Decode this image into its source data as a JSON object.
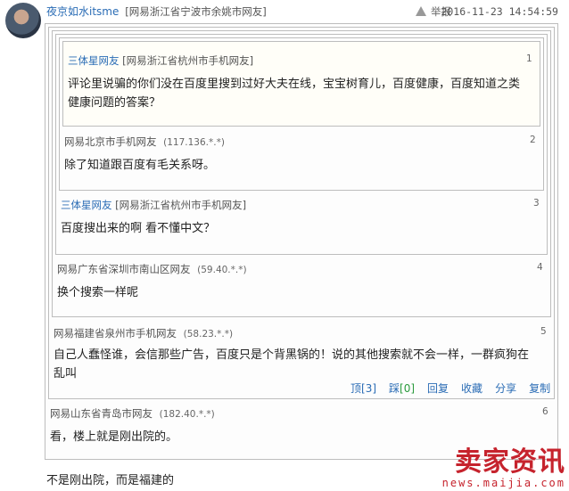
{
  "post": {
    "username": "夜京如水itsme",
    "location": "[网易浙江省宁波市余姚市网友]",
    "report_label": "举报",
    "timestamp": "2016-11-23 14:54:59",
    "text": "不是刚出院，而是福建的"
  },
  "floors": [
    {
      "num": "1",
      "name": "三体星网友",
      "meta": "[网易浙江省杭州市手机网友]",
      "text_lines": [
        "评论里说骗的你们没在百度里搜到过好大夫在线，宝宝树育儿，百度健康，百度知道之类",
        "健康问题的答案？"
      ]
    },
    {
      "num": "2",
      "name": "网易北京市手机网友",
      "ip": "(117.136.*.*)",
      "text_lines": [
        "除了知道跟百度有毛关系呀。"
      ]
    },
    {
      "num": "3",
      "name": "三体星网友",
      "meta": "[网易浙江省杭州市手机网友]",
      "text_lines": [
        "百度搜出来的啊 看不懂中文？"
      ]
    },
    {
      "num": "4",
      "name": "网易广东省深圳市南山区网友",
      "ip": "(59.40.*.*)",
      "text_lines": [
        "换个搜索一样呢"
      ]
    },
    {
      "num": "5",
      "name": "网易福建省泉州市手机网友",
      "ip": "(58.23.*.*)",
      "text_lines": [
        "自己人蠢怪谁，会信那些广告，百度只是个背黑锅的！说的其他搜索就不会一样，一群疯狗在",
        "乱叫"
      ]
    },
    {
      "num": "6",
      "name": "网易山东省青岛市网友",
      "ip": "(182.40.*.*)",
      "text_lines": [
        "看，楼上就是刚出院的。"
      ]
    }
  ],
  "actions": {
    "up_label": "顶",
    "up_count": "[3]",
    "down_label": "踩",
    "down_count": "[0]",
    "reply": "回复",
    "favorite": "收藏",
    "share": "分享",
    "copy": "复制"
  },
  "watermark": {
    "title": "卖家资讯",
    "url": "news.maijia.com",
    "color": "#c6232d"
  },
  "colors": {
    "link": "#2a6cb5",
    "border": "#bdbdbd",
    "accent": "#c6232d"
  }
}
